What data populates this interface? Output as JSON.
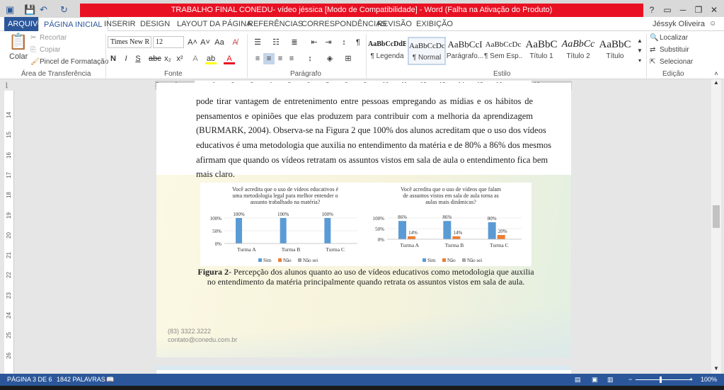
{
  "window": {
    "title": "TRABALHO FINAL CONEDU- vídeo jéssica [Modo de Compatibilidade] - Word (Falha na Ativação do Produto)",
    "help": "?",
    "user": "Jéssyk Oliveira"
  },
  "tabs": [
    {
      "label": "ARQUIVO"
    },
    {
      "label": "PÁGINA INICIAL"
    },
    {
      "label": "INSERIR"
    },
    {
      "label": "DESIGN"
    },
    {
      "label": "LAYOUT DA PÁGINA"
    },
    {
      "label": "REFERÊNCIAS"
    },
    {
      "label": "CORRESPONDÊNCIAS"
    },
    {
      "label": "REVISÃO"
    },
    {
      "label": "EXIBIÇÃO"
    }
  ],
  "ribbon": {
    "clipboard": {
      "paste": "Colar",
      "cut": "Recortar",
      "copy": "Copiar",
      "format_painter": "Pincel de Formatação",
      "label": "Área de Transferência"
    },
    "font": {
      "name": "Times New R",
      "size": "12",
      "label": "Fonte"
    },
    "paragraph": {
      "label": "Parágrafo"
    },
    "styles": {
      "label": "Estilo",
      "items": [
        {
          "preview": "AaBbCcDdE",
          "name": "¶ Legenda"
        },
        {
          "preview": "AaBbCcDc",
          "name": "¶ Normal"
        },
        {
          "preview": "AaBbCcI",
          "name": "Parágrafo..."
        },
        {
          "preview": "AaBbCcDc",
          "name": "¶ Sem Esp..."
        },
        {
          "preview": "AaBbC",
          "name": "Título 1"
        },
        {
          "preview": "AaBbCc",
          "name": "Título 2"
        },
        {
          "preview": "AaBbC",
          "name": "Título"
        }
      ]
    },
    "editing": {
      "find": "Localizar",
      "replace": "Substituir",
      "select": "Selecionar",
      "label": "Edição"
    }
  },
  "ruler": {
    "h_labels": [
      "2",
      "1",
      "",
      "1",
      "2",
      "3",
      "4",
      "5",
      "6",
      "7",
      "8",
      "9",
      "10",
      "11",
      "12",
      "13",
      "14",
      "15",
      "16",
      "",
      "18"
    ],
    "v_labels": [
      "14",
      "15",
      "16",
      "17",
      "18",
      "19",
      "20",
      "21",
      "22",
      "23",
      "24",
      "25",
      "26"
    ]
  },
  "document": {
    "lines": [
      "pode tirar vantagem de entretenimento entre pessoas empregando as mídias e os hábitos de",
      "pensamentos e opiniões que elas produzem para contribuir com a melhoria da aprendizagem",
      "(BURMARK, 2004). Observa-se na Figura 2 que 100% dos alunos acreditam que o uso dos vídeos",
      "educativos é uma metodologia que auxilia no entendimento da matéria e de 80% a 86% dos mesmos",
      "afirmam que quando os vídeos retratam os assuntos vistos em sala de aula o entendimento fica bem",
      "mais claro."
    ],
    "caption_bold": "Figura 2",
    "caption_rest": "- Percepção dos alunos quanto ao uso de vídeos educativos como metodologia que auxilia no entendimento da matéria principalmente quando retrata os assuntos vistos em sala de aula.",
    "footer_phone": "(83) 3322.3222",
    "footer_email": "contato@conedu.com.br"
  },
  "chart_data": [
    {
      "type": "bar",
      "title": "Você acredita que o uso de vídeos educativos é uma metodologia legal para melhor entender o assunto trabalhado na matéria?",
      "title_lines": [
        "Você acredita que o uso de vídeos educativos é",
        "uma metodologia legal para melhor entender o",
        "assunto trabalhado na matéria?"
      ],
      "categories": [
        "Turma A",
        "Turma B",
        "Turma C"
      ],
      "series": [
        {
          "name": "Sim",
          "values": [
            100,
            100,
            100
          ],
          "color": "#5b9bd5"
        },
        {
          "name": "Não",
          "values": [
            0,
            0,
            0
          ],
          "color": "#ed7d31"
        },
        {
          "name": "Não sei",
          "values": [
            0,
            0,
            0
          ],
          "color": "#a5a5a5"
        }
      ],
      "data_labels": [
        "100%",
        "100%",
        "100%"
      ],
      "yticks": [
        "0%",
        "50%",
        "100%"
      ],
      "ylim": [
        0,
        100
      ],
      "legend": "bottom"
    },
    {
      "type": "bar",
      "title": "Você acredita que o uso de vídeos que falam de assuntos vistos em sala de aula torna as aulas mais dinâmicas?",
      "title_lines": [
        "Você acredita que o uso de vídeos que falam",
        "de assuntos vistos em sala de aula torna as",
        "aulas mais dinâmicas?"
      ],
      "categories": [
        "Turma A",
        "Turma B",
        "Turma C"
      ],
      "series": [
        {
          "name": "Sim",
          "values": [
            86,
            86,
            80
          ],
          "color": "#5b9bd5"
        },
        {
          "name": "Não",
          "values": [
            14,
            14,
            20
          ],
          "color": "#ed7d31"
        },
        {
          "name": "Não sei",
          "values": [
            0,
            0,
            0
          ],
          "color": "#a5a5a5"
        }
      ],
      "data_labels_sim": [
        "86%",
        "86%",
        "80%"
      ],
      "data_labels_nao": [
        "14%",
        "14%",
        "20%"
      ],
      "yticks": [
        "0%",
        "50%",
        "100%"
      ],
      "ylim": [
        0,
        100
      ],
      "legend": "bottom"
    }
  ],
  "status": {
    "page": "PÁGINA 3 DE 6",
    "words": "1842 PALAVRAS",
    "zoom": "100%"
  },
  "colors": {
    "accent": "#2b579a",
    "title_red": "#e81123"
  }
}
